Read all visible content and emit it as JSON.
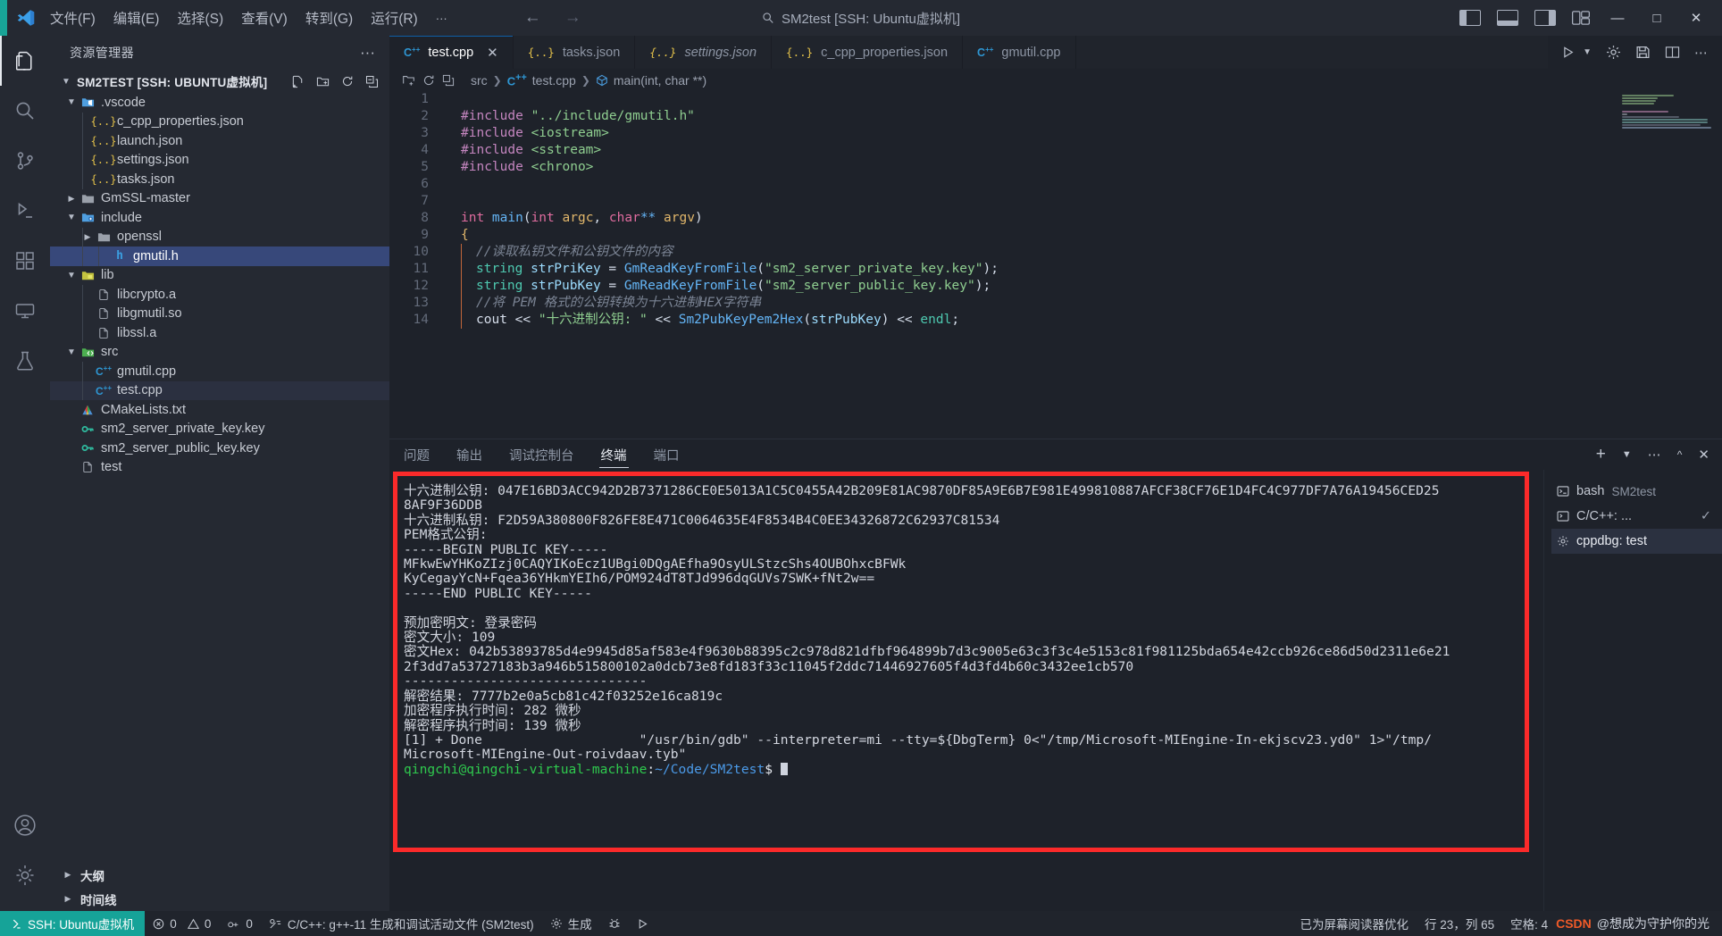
{
  "titlebar": {
    "menus": [
      "文件(F)",
      "编辑(E)",
      "选择(S)",
      "查看(V)",
      "转到(G)",
      "运行(R)",
      "···"
    ],
    "nav_back": "←",
    "nav_forward": "→",
    "search_icon": "search-icon",
    "window_title": "SM2test [SSH: Ubuntu虚拟机]",
    "window_buttons": [
      "—",
      "□",
      "✕"
    ],
    "layout_icons": [
      "layout-sidebar-left-icon",
      "layout-panel-icon",
      "layout-sidebar-right-icon",
      "layout-grid-icon"
    ],
    "accent_color": "#18a497"
  },
  "activitybar": {
    "items": [
      {
        "name": "explorer",
        "glyph": "files-icon",
        "selected": true
      },
      {
        "name": "search",
        "glyph": "search-icon",
        "selected": false
      },
      {
        "name": "source-control",
        "glyph": "source-control-icon",
        "selected": false
      },
      {
        "name": "run-and-debug",
        "glyph": "run-debug-icon",
        "selected": false
      },
      {
        "name": "extensions",
        "glyph": "extensions-icon",
        "selected": false
      },
      {
        "name": "remote-explorer",
        "glyph": "remote-explorer-icon",
        "selected": false
      },
      {
        "name": "testing",
        "glyph": "beaker-icon",
        "selected": false
      }
    ],
    "bottom": [
      {
        "name": "accounts",
        "glyph": "account-icon"
      },
      {
        "name": "manage",
        "glyph": "gear-icon"
      }
    ]
  },
  "explorer": {
    "title": "资源管理器",
    "more_actions": "···",
    "root_label": "SM2TEST [SSH: UBUNTU虚拟机]",
    "root_actions": [
      "new-file-icon",
      "new-folder-icon",
      "refresh-icon",
      "collapse-all-icon"
    ],
    "tree": [
      {
        "label": ".vscode",
        "depth": 1,
        "type": "folder-vscode",
        "expanded": true,
        "state": "normal"
      },
      {
        "label": "c_cpp_properties.json",
        "depth": 2,
        "type": "json",
        "state": "normal"
      },
      {
        "label": "launch.json",
        "depth": 2,
        "type": "json",
        "state": "normal"
      },
      {
        "label": "settings.json",
        "depth": 2,
        "type": "json",
        "state": "normal"
      },
      {
        "label": "tasks.json",
        "depth": 2,
        "type": "json",
        "state": "normal"
      },
      {
        "label": "GmSSL-master",
        "depth": 1,
        "type": "folder",
        "expanded": false,
        "state": "normal"
      },
      {
        "label": "include",
        "depth": 1,
        "type": "folder-include",
        "expanded": true,
        "state": "normal"
      },
      {
        "label": "openssl",
        "depth": 2,
        "type": "folder",
        "expanded": false,
        "state": "normal"
      },
      {
        "label": "gmutil.h",
        "depth": 3,
        "type": "header",
        "state": "selected"
      },
      {
        "label": "lib",
        "depth": 1,
        "type": "folder-lib",
        "expanded": true,
        "state": "normal"
      },
      {
        "label": "libcrypto.a",
        "depth": 2,
        "type": "file",
        "state": "normal"
      },
      {
        "label": "libgmutil.so",
        "depth": 2,
        "type": "file",
        "state": "normal"
      },
      {
        "label": "libssl.a",
        "depth": 2,
        "type": "file",
        "state": "normal"
      },
      {
        "label": "src",
        "depth": 1,
        "type": "folder-src",
        "expanded": true,
        "state": "normal"
      },
      {
        "label": "gmutil.cpp",
        "depth": 2,
        "type": "cpp",
        "state": "normal"
      },
      {
        "label": "test.cpp",
        "depth": 2,
        "type": "cpp",
        "state": "active"
      },
      {
        "label": "CMakeLists.txt",
        "depth": 1,
        "type": "cmake",
        "state": "normal"
      },
      {
        "label": "sm2_server_private_key.key",
        "depth": 1,
        "type": "key",
        "state": "normal"
      },
      {
        "label": "sm2_server_public_key.key",
        "depth": 1,
        "type": "key",
        "state": "normal"
      },
      {
        "label": "test",
        "depth": 1,
        "type": "file",
        "state": "normal"
      }
    ],
    "bottom_sections": [
      "大纲",
      "时间线"
    ]
  },
  "editor": {
    "tabs": [
      {
        "label": "test.cpp",
        "icon": "cpp-icon",
        "active": true,
        "italic": false,
        "close": "✕"
      },
      {
        "label": "tasks.json",
        "icon": "json-icon",
        "active": false,
        "italic": false
      },
      {
        "label": "settings.json",
        "icon": "json-icon",
        "active": false,
        "italic": true
      },
      {
        "label": "c_cpp_properties.json",
        "icon": "json-icon",
        "active": false,
        "italic": false
      },
      {
        "label": "gmutil.cpp",
        "icon": "cpp-icon",
        "active": false,
        "italic": false
      }
    ],
    "tab_actions": [
      "run-with-debug-icon",
      "settings-gear-icon",
      "save-all-icon",
      "split-editor-icon",
      "more-actions-icon"
    ],
    "breadcrumb": [
      "src",
      "test.cpp",
      "main(int, char **)"
    ],
    "lines": [
      {
        "n": 1,
        "segments": []
      },
      {
        "n": 2,
        "segments": [
          {
            "t": "#include ",
            "c": "pre"
          },
          {
            "t": "\"../include/gmutil.h\"",
            "c": "str"
          }
        ]
      },
      {
        "n": 3,
        "segments": [
          {
            "t": "#include ",
            "c": "pre"
          },
          {
            "t": "<iostream>",
            "c": "str"
          }
        ]
      },
      {
        "n": 4,
        "segments": [
          {
            "t": "#include ",
            "c": "pre"
          },
          {
            "t": "<sstream>",
            "c": "str"
          }
        ]
      },
      {
        "n": 5,
        "segments": [
          {
            "t": "#include ",
            "c": "pre"
          },
          {
            "t": "<chrono>",
            "c": "str"
          }
        ]
      },
      {
        "n": 6,
        "segments": []
      },
      {
        "n": 7,
        "segments": []
      },
      {
        "n": 8,
        "segments": [
          {
            "t": "int ",
            "c": "type"
          },
          {
            "t": "main",
            "c": "fn"
          },
          {
            "t": "(",
            "c": "punct"
          },
          {
            "t": "int ",
            "c": "type"
          },
          {
            "t": "argc",
            "c": "orange"
          },
          {
            "t": ", ",
            "c": "punct"
          },
          {
            "t": "char",
            "c": "type"
          },
          {
            "t": "** ",
            "c": "fn"
          },
          {
            "t": "argv",
            "c": "orange"
          },
          {
            "t": ")",
            "c": "punct"
          }
        ]
      },
      {
        "n": 9,
        "segments": [
          {
            "t": "{",
            "c": "orange"
          }
        ]
      },
      {
        "n": 10,
        "indent": true,
        "segments": [
          {
            "t": "//读取私钥文件和公钥文件的内容",
            "c": "cmt"
          }
        ]
      },
      {
        "n": 11,
        "indent": true,
        "segments": [
          {
            "t": "string ",
            "c": "teal"
          },
          {
            "t": "strPriKey ",
            "c": "var"
          },
          {
            "t": "= ",
            "c": "punct"
          },
          {
            "t": "GmReadKeyFromFile",
            "c": "fn"
          },
          {
            "t": "(",
            "c": "punct"
          },
          {
            "t": "\"sm2_server_private_key.key\"",
            "c": "str"
          },
          {
            "t": ");",
            "c": "punct"
          }
        ]
      },
      {
        "n": 12,
        "indent": true,
        "segments": [
          {
            "t": "string ",
            "c": "teal"
          },
          {
            "t": "strPubKey ",
            "c": "var"
          },
          {
            "t": "= ",
            "c": "punct"
          },
          {
            "t": "GmReadKeyFromFile",
            "c": "fn"
          },
          {
            "t": "(",
            "c": "punct"
          },
          {
            "t": "\"sm2_server_public_key.key\"",
            "c": "str"
          },
          {
            "t": ");",
            "c": "punct"
          }
        ]
      },
      {
        "n": 13,
        "indent": true,
        "segments": [
          {
            "t": "//将 PEM 格式的公钥转换为十六进制HEX字符串",
            "c": "cmt"
          }
        ]
      },
      {
        "n": 14,
        "indent": true,
        "segments": [
          {
            "t": "cout ",
            "c": "id"
          },
          {
            "t": "<< ",
            "c": "punct"
          },
          {
            "t": "\"十六进制公钥: \" ",
            "c": "str"
          },
          {
            "t": "<< ",
            "c": "punct"
          },
          {
            "t": "Sm2PubKeyPem2Hex",
            "c": "fn"
          },
          {
            "t": "(",
            "c": "punct"
          },
          {
            "t": "strPubKey",
            "c": "var"
          },
          {
            "t": ") ",
            "c": "punct"
          },
          {
            "t": "<< ",
            "c": "punct"
          },
          {
            "t": "endl",
            "c": "teal"
          },
          {
            "t": ";",
            "c": "punct"
          }
        ]
      }
    ]
  },
  "panel": {
    "tabs": [
      {
        "label": "问题",
        "selected": false
      },
      {
        "label": "输出",
        "selected": false
      },
      {
        "label": "调试控制台",
        "selected": false
      },
      {
        "label": "终端",
        "selected": true
      },
      {
        "label": "端口",
        "selected": false
      }
    ],
    "actions": [
      "new-terminal-icon",
      "chevron-down-icon",
      "more-actions-icon",
      "maximize-panel-icon",
      "close-panel-icon"
    ],
    "terminal_border_color": "#fb2a2a",
    "terminal_lines": [
      {
        "text": "十六进制公钥: 047E16BD3ACC942D2B7371286CE0E5013A1C5C0455A42B209E81AC9870DF85A9E6B7E981E499810887AFCF38CF76E1D4FC4C977DF7A76A19456CED25",
        "color": "default"
      },
      {
        "text": "8AF9F36DDB",
        "color": "default"
      },
      {
        "text": "十六进制私钥: F2D59A380800F826FE8E471C0064635E4F8534B4C0EE34326872C62937C81534",
        "color": "default"
      },
      {
        "text": "PEM格式公钥:",
        "color": "default"
      },
      {
        "text": "-----BEGIN PUBLIC KEY-----",
        "color": "default"
      },
      {
        "text": "MFkwEwYHKoZIzj0CAQYIKoEcz1UBgi0DQgAEfha9OsyULStzcShs4OUBOhxcBFWk",
        "color": "default"
      },
      {
        "text": "KyCegayYcN+Fqea36YHkmYEIh6/POM924dT8TJd996dqGUVs7SWK+fNt2w==",
        "color": "default"
      },
      {
        "text": "-----END PUBLIC KEY-----",
        "color": "default"
      },
      {
        "text": "",
        "color": "default"
      },
      {
        "text": "预加密明文: 登录密码",
        "color": "default"
      },
      {
        "text": "密文大小: 109",
        "color": "default"
      },
      {
        "text": "密文Hex: 042b53893785d4e9945d85af583e4f9630b88395c2c978d821dfbf964899b7d3c9005e63c3f3c4e5153c81f981125bda654e42ccb926ce86d50d2311e6e21",
        "color": "default"
      },
      {
        "text": "2f3dd7a53727183b3a946b515800102a0dcb73e8fd183f33c11045f2ddc71446927605f4d3fd4b60c3432ee1cb570",
        "color": "default"
      },
      {
        "text": "-------------------------------",
        "color": "default"
      },
      {
        "text": "解密结果: 7777b2e0a5cb81c42f03252e16ca819c",
        "color": "default"
      },
      {
        "text": "加密程序执行时间: 282 微秒",
        "color": "default"
      },
      {
        "text": "解密程序执行时间: 139 微秒",
        "color": "default"
      },
      {
        "text": "[1] + Done                    \"/usr/bin/gdb\" --interpreter=mi --tty=${DbgTerm} 0<\"/tmp/Microsoft-MIEngine-In-ekjscv23.yd0\" 1>\"/tmp/",
        "color": "default"
      },
      {
        "text": "Microsoft-MIEngine-Out-roivdaav.tyb\"",
        "color": "default"
      }
    ],
    "prompt": {
      "user_host": "qingchi@qingchi-virtual-machine",
      "colon": ":",
      "path": "~/Code/SM2test",
      "symbol": "$"
    },
    "terminal_list": [
      {
        "label": "bash",
        "detail": "SM2test",
        "icon": "terminal-icon",
        "selected": false,
        "check": ""
      },
      {
        "label": "C/C++: ...",
        "detail": "",
        "icon": "terminal-debug-icon",
        "selected": false,
        "check": "✓"
      },
      {
        "label": "cppdbg: test",
        "detail": "",
        "icon": "gear-icon",
        "selected": true,
        "check": ""
      }
    ]
  },
  "statusbar": {
    "remote_label": "SSH: Ubuntu虚拟机",
    "remote_icon": "remote-icon",
    "errors": "0",
    "warnings": "0",
    "ports": "0",
    "build_task": "C/C++: g++-11 生成和调试活动文件 (SM2test)",
    "build_label": "生成",
    "bug_icon": "bug-icon",
    "run_icon": "run-icon",
    "screen_reader": "已为屏幕阅读器优化",
    "cursor_position": "行 23，列 65",
    "indentation": "空格: 4",
    "watermark": "CSDN @想成为守护你的光",
    "remote_color": "#16a398"
  }
}
